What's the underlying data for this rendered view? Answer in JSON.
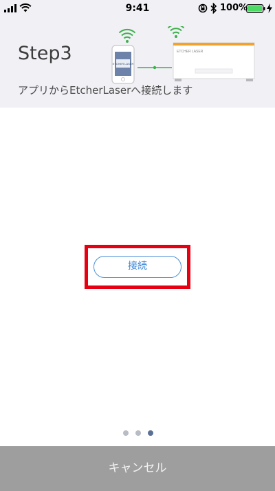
{
  "status_bar": {
    "time": "9:41",
    "battery_percent": "100%",
    "battery_level": 1.0,
    "icons": [
      "signal-icon",
      "wifi-icon",
      "rotation-lock-icon",
      "bluetooth-icon",
      "battery-icon",
      "charging-icon"
    ]
  },
  "header": {
    "title": "Step3",
    "description": "アプリからEtcherLaserへ接続します",
    "illustration": {
      "device_screen_text": "ETCHER LASER",
      "device_name_label": "ETCHER LASER",
      "icons": [
        "wifi-icon",
        "smartphone-icon",
        "laser-machine-icon"
      ]
    }
  },
  "main": {
    "connect_label": "接続"
  },
  "pagination": {
    "total": 3,
    "current": 3
  },
  "footer": {
    "cancel_label": "キャンセル"
  },
  "colors": {
    "accent_blue": "#2f7fd6",
    "highlight_red": "#e60012",
    "wifi_green": "#3cb04a",
    "machine_orange": "#f4a12a",
    "header_bg": "#f0f0f5",
    "cancel_bg": "#9e9e9e"
  }
}
